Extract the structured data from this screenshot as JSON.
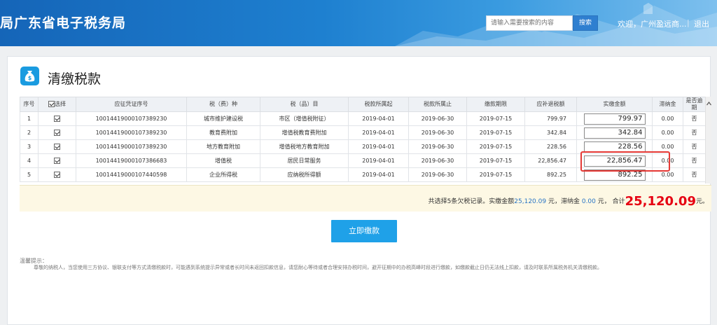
{
  "header": {
    "site_title": "局广东省电子税务局",
    "search_placeholder": "请输入需要搜索的内容",
    "search_button": "搜索",
    "welcome": "欢迎，广州盈远商...",
    "separator": "|",
    "logout": "退出"
  },
  "page": {
    "title": "清缴税款",
    "icon": "money-bag-icon"
  },
  "table": {
    "headers": [
      "序号",
      "选择",
      "应征凭证序号",
      "税（费）种",
      "税（品）目",
      "税款所属起",
      "税款所属止",
      "缴款期限",
      "应补退税额",
      "实缴金额",
      "滞纳金",
      "是否逾期"
    ],
    "rows": [
      {
        "seq": "1",
        "cert": "10014419000107389230",
        "tax_type": "城市维护建设税",
        "item": "市区（增值税附征）",
        "start": "2019-04-01",
        "end": "2019-06-30",
        "deadline": "2019-07-15",
        "due": "799.97",
        "paid": "799.97",
        "late_fee": "0.00",
        "overdue": "否"
      },
      {
        "seq": "2",
        "cert": "10014419000107389230",
        "tax_type": "教育费附加",
        "item": "增值税教育费附加",
        "start": "2019-04-01",
        "end": "2019-06-30",
        "deadline": "2019-07-15",
        "due": "342.84",
        "paid": "342.84",
        "late_fee": "0.00",
        "overdue": "否"
      },
      {
        "seq": "3",
        "cert": "10014419000107389230",
        "tax_type": "地方教育附加",
        "item": "增值税地方教育附加",
        "start": "2019-04-01",
        "end": "2019-06-30",
        "deadline": "2019-07-15",
        "due": "228.56",
        "paid": "228.56",
        "late_fee": "0.00",
        "overdue": "否"
      },
      {
        "seq": "4",
        "cert": "10014419000107386683",
        "tax_type": "增值税",
        "item": "居民日常服务",
        "start": "2019-04-01",
        "end": "2019-06-30",
        "deadline": "2019-07-15",
        "due": "22,856.47",
        "paid": "22,856.47",
        "late_fee": "0.00",
        "overdue": "否"
      },
      {
        "seq": "5",
        "cert": "10014419000107440598",
        "tax_type": "企业所得税",
        "item": "应纳税所得额",
        "start": "2019-04-01",
        "end": "2019-06-30",
        "deadline": "2019-07-15",
        "due": "892.25",
        "paid": "892.25",
        "late_fee": "0.00",
        "overdue": "否"
      }
    ]
  },
  "summary": {
    "p1": "共选择5条欠税记录。实缴金额",
    "paid_total": "25,120.09",
    "p2": " 元，滞纳金 ",
    "late_total": "0.00",
    "p3": " 元， 合计",
    "grand_total": "25,120.09",
    "p4": "元。"
  },
  "pay_button": "立即缴款",
  "tips": {
    "title": "温馨提示：",
    "body": "尊敬的纳税人，当您使用三方协议、银联支付等方式清缴税款时，可能遇到系统提示异常或者长时间未返回扣款信息，请您耐心等待或者合理安排办税时间，避开征期中的办税高峰时段进行缴款，如缴款截止日仍无法线上扣款，请及时联系所属税务机关清缴税款。"
  },
  "colors": {
    "header_blue": "#1e80d0",
    "accent_blue": "#1fa1e8",
    "total_red": "#e60012",
    "highlight_red": "#e53935"
  }
}
